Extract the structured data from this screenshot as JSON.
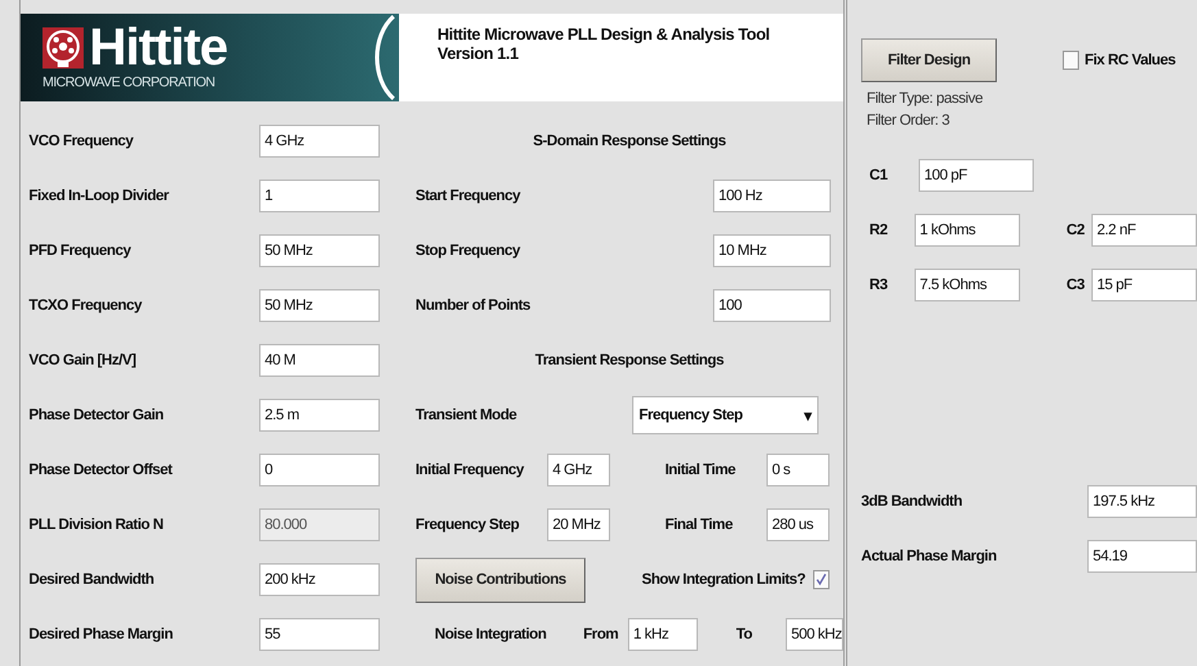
{
  "header": {
    "logo_name": "Hittite",
    "logo_sub": "MICROWAVE CORPORATION",
    "title": "Hittite Microwave PLL Design & Analysis Tool",
    "version": "Version 1.1"
  },
  "inputs": [
    {
      "label": "VCO Frequency",
      "value": "4 GHz",
      "disabled": false
    },
    {
      "label": "Fixed In-Loop Divider",
      "value": "1",
      "disabled": false
    },
    {
      "label": "PFD Frequency",
      "value": "50 MHz",
      "disabled": false
    },
    {
      "label": "TCXO Frequency",
      "value": "50 MHz",
      "disabled": false
    },
    {
      "label": "VCO Gain [Hz/V]",
      "value": "40 M",
      "disabled": false
    },
    {
      "label": "Phase Detector Gain",
      "value": "2.5 m",
      "disabled": false
    },
    {
      "label": "Phase Detector Offset",
      "value": "0",
      "disabled": false
    },
    {
      "label": "PLL Division Ratio N",
      "value": "80.000",
      "disabled": true
    },
    {
      "label": "Desired Bandwidth",
      "value": "200 kHz",
      "disabled": false
    },
    {
      "label": "Desired Phase Margin",
      "value": "55",
      "disabled": false
    }
  ],
  "s_domain": {
    "title": "S-Domain Response Settings",
    "fields": [
      {
        "label": "Start Frequency",
        "value": "100 Hz"
      },
      {
        "label": "Stop Frequency",
        "value": "10 MHz"
      },
      {
        "label": "Number of Points",
        "value": "100"
      }
    ]
  },
  "transient": {
    "title": "Transient Response Settings",
    "mode_label": "Transient Mode",
    "mode_value": "Frequency Step",
    "arrow": "▾",
    "fields": [
      {
        "label": "Initial Frequency",
        "value": "4 GHz"
      },
      {
        "label": "Initial Time",
        "value": "0 s"
      },
      {
        "label": "Frequency Step",
        "value": "20 MHz"
      },
      {
        "label": "Final Time",
        "value": "280 us"
      }
    ]
  },
  "noise": {
    "button": "Noise Contributions",
    "show_limits_label": "Show Integration Limits?",
    "show_limits_checked": true,
    "integration_label": "Noise Integration",
    "from_label": "From",
    "from_value": "1 kHz",
    "to_label": "To",
    "to_value": "500 kHz"
  },
  "filter": {
    "button": "Filter Design",
    "fix_rc": {
      "label": "Fix RC Values",
      "checked": false
    },
    "type": "Filter Type: passive",
    "order": "Filter Order: 3",
    "components": [
      [
        {
          "label": "C1",
          "value": "100 pF"
        }
      ],
      [
        {
          "label": "R2",
          "value": "1 kOhms"
        },
        {
          "label": "C2",
          "value": "2.2 nF"
        }
      ],
      [
        {
          "label": "R3",
          "value": "7.5 kOhms"
        },
        {
          "label": "C3",
          "value": "15 pF"
        }
      ]
    ]
  },
  "results": [
    {
      "label": "3dB Bandwidth",
      "value": "197.5 kHz"
    },
    {
      "label": "Actual Phase Margin",
      "value": "54.19"
    }
  ]
}
